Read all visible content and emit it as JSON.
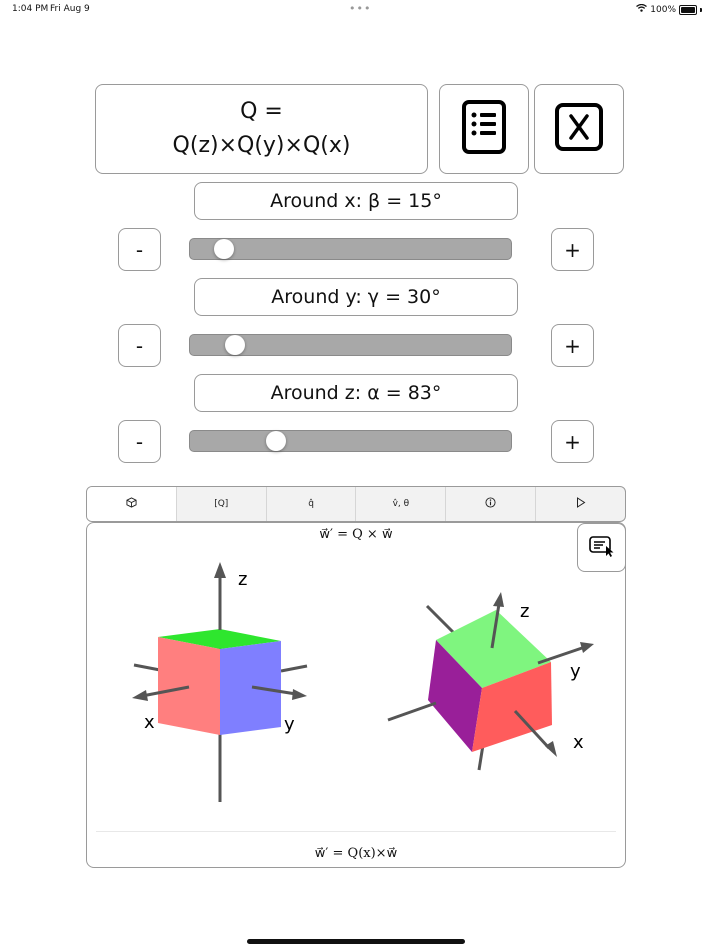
{
  "status_bar": {
    "time": "1:04 PM",
    "date": "Fri Aug 9",
    "battery": "100%",
    "dots": "•••"
  },
  "header": {
    "formula_line1": "Q =",
    "formula_line2": "Q(z)×Q(y)×Q(x)"
  },
  "controls": [
    {
      "label": "Around x: β = 15°",
      "value": 15
    },
    {
      "label": "Around y: γ = 30°",
      "value": 30
    },
    {
      "label": "Around z: α = 83°",
      "value": 83
    }
  ],
  "slider_range": [
    0,
    360
  ],
  "buttons": {
    "minus": "-",
    "plus": "+"
  },
  "tabs": [
    {
      "label": "",
      "icon": "cube-icon"
    },
    {
      "label": "[Q]"
    },
    {
      "label": "q̂"
    },
    {
      "label": "v̂, θ"
    },
    {
      "label": "",
      "icon": "info-icon"
    },
    {
      "label": "",
      "icon": "play-icon"
    }
  ],
  "panel": {
    "top_formula": "w⃗′ = Q × w⃗",
    "bottom_formula": "w⃗′ = Q(x)×w⃗",
    "left_axes": {
      "z": "z",
      "x": "x",
      "y": "y"
    },
    "right_axes": {
      "z": "z",
      "x": "x",
      "y": "y"
    }
  },
  "colors": {
    "cube_top_left": "#2ee62e",
    "cube_left_left": "#ff7f7f",
    "cube_right_left": "#7f7fff",
    "cube_top_right": "#7ff57f",
    "cube_left_right": "#991f99",
    "cube_right_right": "#ff5c5c",
    "axis": "#555555"
  }
}
